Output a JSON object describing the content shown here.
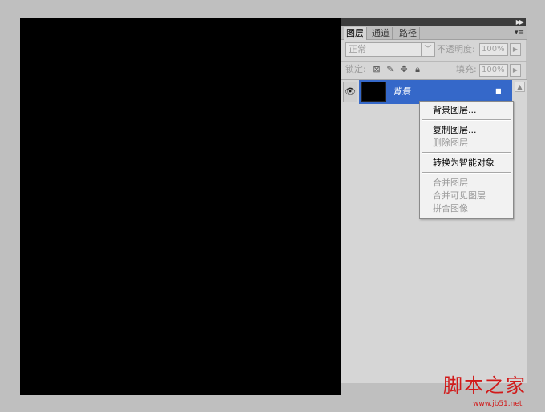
{
  "canvas": {
    "background": "#000000"
  },
  "panel": {
    "tabs": [
      {
        "label": "图层",
        "active": true
      },
      {
        "label": "通道",
        "active": false
      },
      {
        "label": "路径",
        "active": false
      }
    ],
    "blend_mode": "正常",
    "opacity_label": "不透明度:",
    "opacity_value": "100%",
    "lock_label": "锁定:",
    "fill_label": "填充:",
    "fill_value": "100%",
    "icons": {
      "collapse": "double-chevron-right-icon",
      "panel_menu": "panel-menu-icon",
      "lock_transparent": "lock-transparent-pixels-icon",
      "lock_image": "brush-icon",
      "lock_position": "move-icon",
      "lock_all": "lock-icon",
      "visibility": "eye-icon"
    }
  },
  "layers": [
    {
      "name": "背景",
      "selected": true,
      "locked": true
    }
  ],
  "context_menu": {
    "items": [
      {
        "label": "背景图层...",
        "enabled": true
      },
      {
        "label": "复制图层...",
        "enabled": true
      },
      {
        "label": "删除图层",
        "enabled": false
      },
      {
        "label": "转换为智能对象",
        "enabled": true
      },
      {
        "label": "合并图层",
        "enabled": false
      },
      {
        "label": "合并可见图层",
        "enabled": false
      },
      {
        "label": "拼合图像",
        "enabled": false
      }
    ]
  },
  "watermark": {
    "text": "脚本之家",
    "url": "www.jb51.net"
  },
  "colors": {
    "selection": "#3568c9",
    "panel_bg": "#d6d6d6",
    "watermark": "#d11a1a"
  }
}
